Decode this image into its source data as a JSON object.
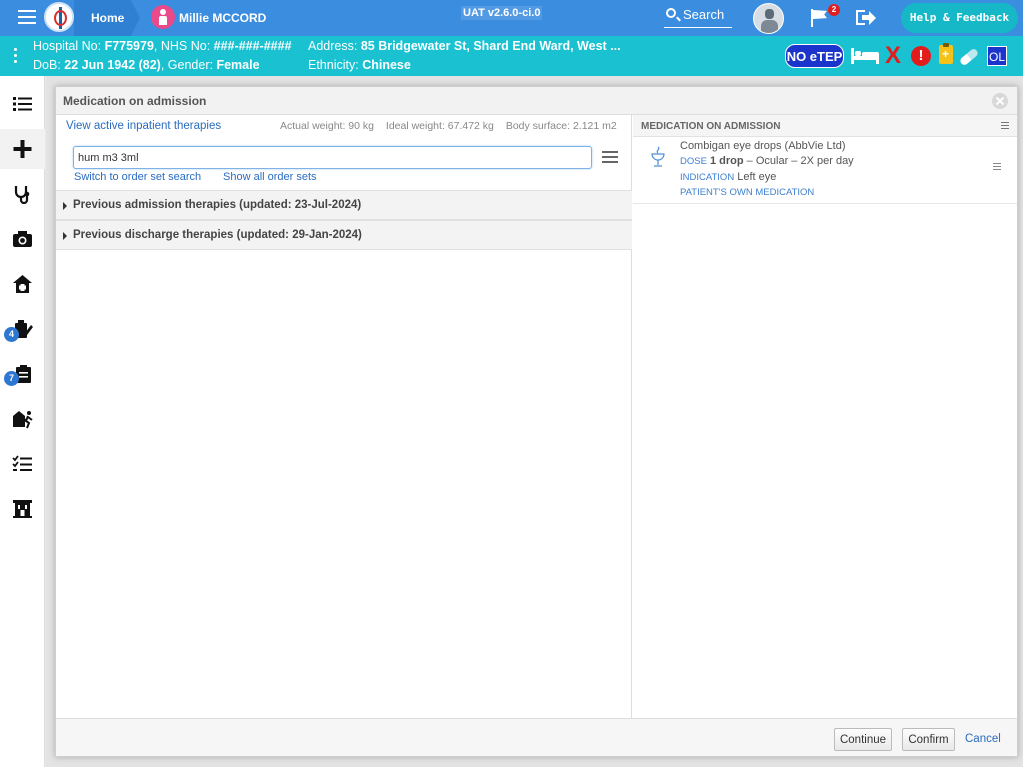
{
  "topbar": {
    "home_label": "Home",
    "patient_name": "Millie MCCORD",
    "environment": "UAT v2.6.0-ci.0",
    "search_label": "Search",
    "flag_count": "2",
    "help_label": "Help & Feedback",
    "colors": {
      "bar": "#3b8de0",
      "help": "#16b8c7"
    }
  },
  "banner": {
    "hospital_label": "Hospital No: ",
    "hospital_no": "F775979",
    "nhs_label": ", NHS No: ",
    "nhs_no": "###-###-####",
    "address_label": "Address: ",
    "address": "85 Bridgewater St, Shard End Ward, West ...",
    "dob_label": "DoB: ",
    "dob": "22 Jun 1942 (82)",
    "gender_label": ", Gender: ",
    "gender": "Female",
    "ethnicity_label": "Ethnicity: ",
    "ethnicity": "Chinese",
    "no_etep": "NO eTEP",
    "alert_x": "X",
    "alert_bang": "!",
    "ol": "OL",
    "colors": {
      "banner": "#19c1d1",
      "alert": "#e41b1b",
      "badge": "#1b34cc"
    }
  },
  "rail": {
    "badges": {
      "prescribe": "4",
      "tasks": "7"
    }
  },
  "modal": {
    "title": "Medication on admission",
    "active_link": "View active inpatient therapies",
    "actual_weight": "Actual weight: 90 kg",
    "ideal_weight": "Ideal weight: 67.472 kg",
    "body_surface": "Body surface: 2.121 m2",
    "search_value": "hum m3 3ml",
    "switch_link": "Switch to order set search",
    "show_all_link": "Show all order sets",
    "sections": [
      {
        "label": "Previous admission therapies (updated: 23-Jul-2024)"
      },
      {
        "label": "Previous discharge therapies (updated: 29-Jan-2024)"
      }
    ],
    "right": {
      "title": "MEDICATION ON ADMISSION",
      "item": {
        "name": "Combigan eye drops (AbbVie Ltd)",
        "dose_label": "DOSE",
        "dose_value": "1 drop",
        "dose_rest": " – Ocular – 2X per day",
        "indication_label": "INDICATION",
        "indication_value": "Left eye",
        "own_label": "PATIENT'S OWN MEDICATION"
      }
    },
    "footer": {
      "continue": "Continue",
      "confirm": "Confirm",
      "cancel": "Cancel"
    }
  }
}
